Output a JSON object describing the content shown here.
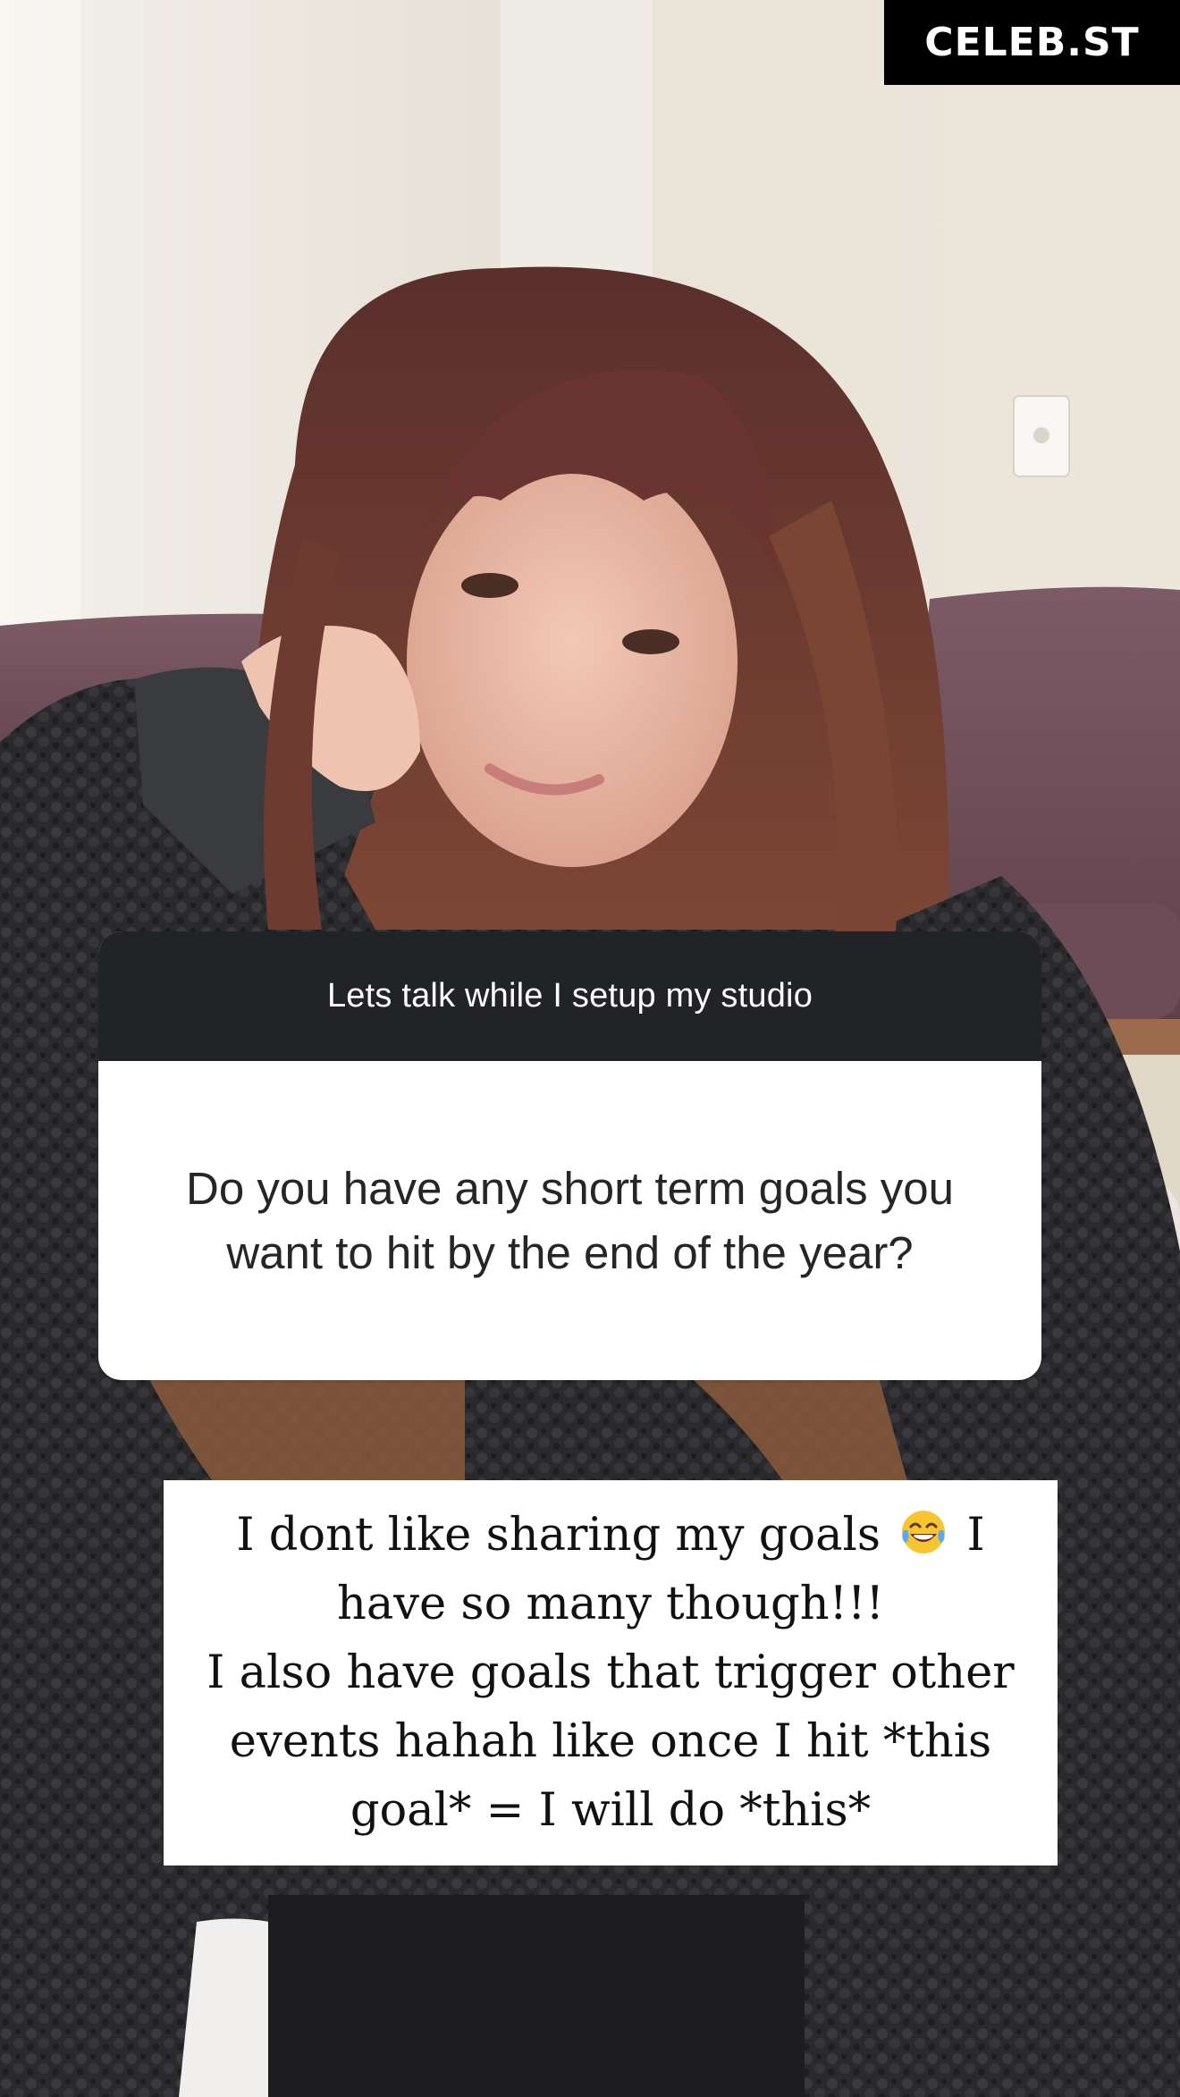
{
  "watermark": {
    "text": "CELEB.ST"
  },
  "question_sticker": {
    "header": "Lets talk while I setup my studio",
    "question": "Do you have any short term goals you want to hit by the end of the year?"
  },
  "answer": {
    "line1_before_emoji": "I dont like sharing my goals ",
    "emoji_icon": "tears-of-joy-emoji-icon",
    "line1_after_emoji": " I",
    "line2": "have so many though!!!",
    "line3": "I also have goals that trigger other",
    "line4": "events hahah like once I hit *this",
    "line5": "goal* = I will do *this*"
  }
}
